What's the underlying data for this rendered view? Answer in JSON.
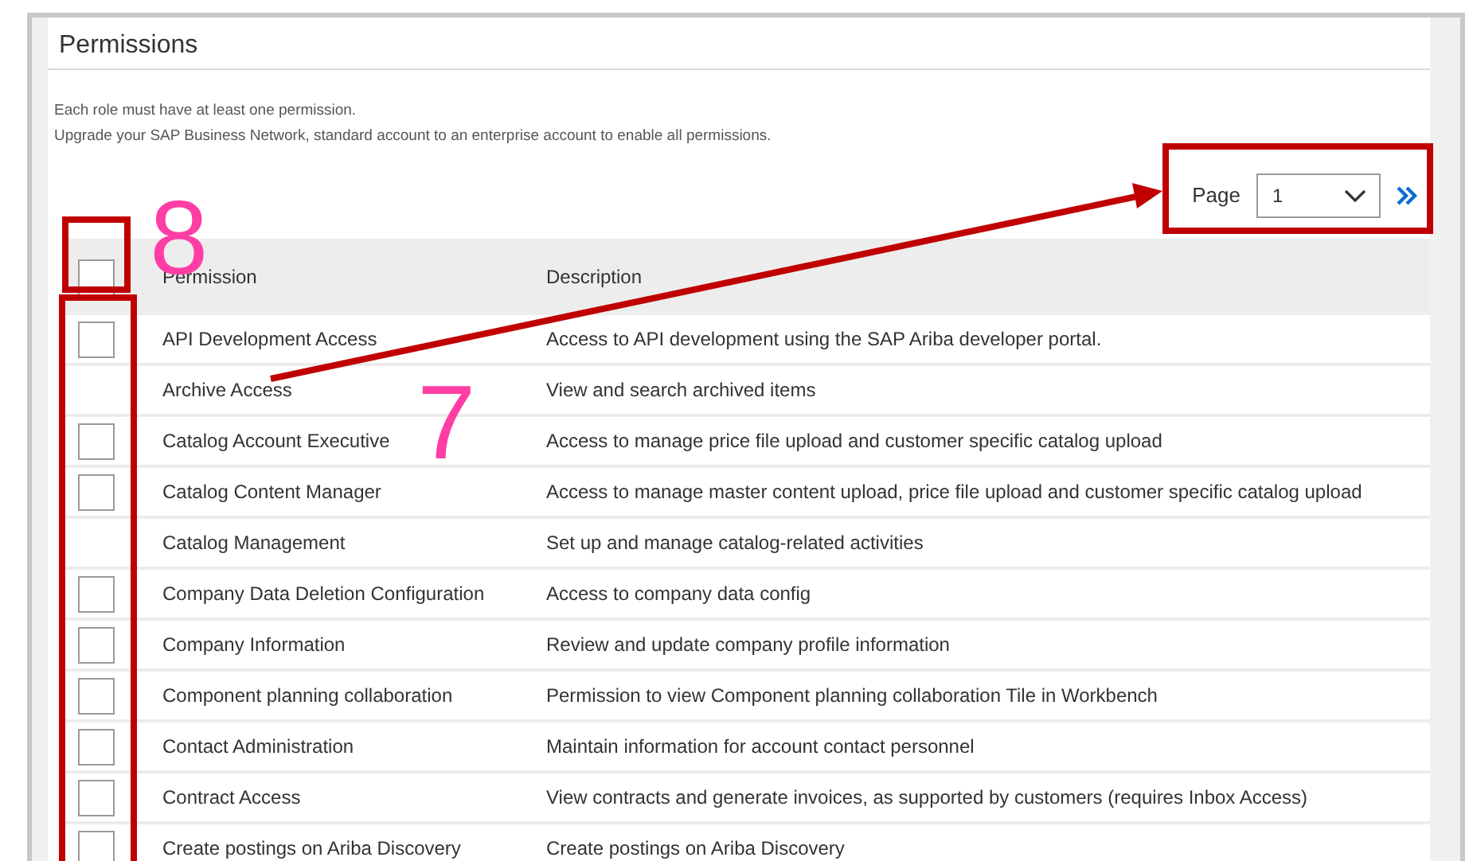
{
  "title": "Permissions",
  "notes": [
    "Each role must have at least one permission.",
    "Upgrade your SAP Business Network, standard account to an enterprise account to enable all permissions."
  ],
  "pager": {
    "label": "Page",
    "value": "1"
  },
  "select_all": {
    "checked": false
  },
  "columns": [
    "Permission",
    "Description"
  ],
  "rows": [
    {
      "kind": "checkbox",
      "checked": false,
      "permission": "API Development Access",
      "description": "Access to API development using the SAP Ariba developer portal."
    },
    {
      "kind": "plain",
      "permission": "Archive Access",
      "description": "View and search archived items"
    },
    {
      "kind": "checkbox",
      "checked": false,
      "permission": "Catalog Account Executive",
      "description": "Access to manage price file upload and customer specific catalog upload"
    },
    {
      "kind": "checkbox",
      "checked": false,
      "permission": "Catalog Content Manager",
      "description": "Access to manage master content upload, price file upload and customer specific catalog upload"
    },
    {
      "kind": "plain",
      "permission": "Catalog Management",
      "description": "Set up and manage catalog-related activities"
    },
    {
      "kind": "checkbox",
      "checked": false,
      "permission": "Company Data Deletion Configuration",
      "description": "Access to company data config"
    },
    {
      "kind": "checkbox",
      "checked": false,
      "permission": "Company Information",
      "description": "Review and update company profile information"
    },
    {
      "kind": "checkbox",
      "checked": false,
      "permission": "Component planning collaboration",
      "description": "Permission to view Component planning collaboration Tile in Workbench"
    },
    {
      "kind": "checkbox",
      "checked": false,
      "permission": "Contact Administration",
      "description": "Maintain information for account contact personnel"
    },
    {
      "kind": "checkbox",
      "checked": false,
      "permission": "Contract Access",
      "description": "View contracts and generate invoices, as supported by customers (requires Inbox Access)"
    },
    {
      "kind": "checkbox",
      "checked": false,
      "permission": "Create postings on Ariba Discovery",
      "description": "Create postings on Ariba Discovery"
    }
  ],
  "annotations": [
    {
      "kind": "box"
    },
    {
      "kind": "box"
    },
    {
      "kind": "box"
    },
    {
      "kind": "number",
      "text": "8"
    },
    {
      "kind": "number",
      "text": "7"
    },
    {
      "kind": "arrow"
    }
  ]
}
